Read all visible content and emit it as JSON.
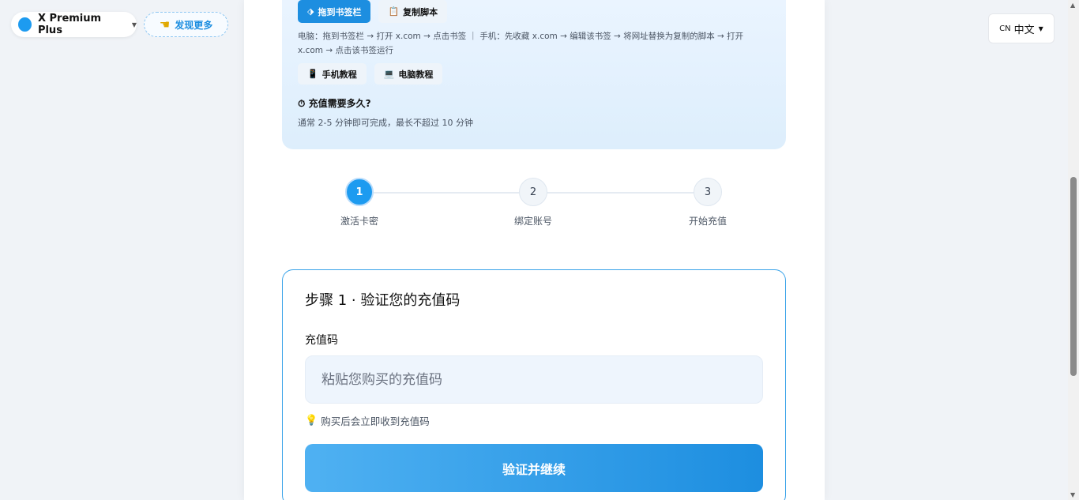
{
  "header": {
    "product_name": "X Premium Plus",
    "discover_label": "发现更多",
    "lang_flag": "CN",
    "lang_label": "中文"
  },
  "info": {
    "drag_bookmark_label": "拖到书签栏",
    "copy_script_label": "复制脚本",
    "instructions": "电脑：拖到书签栏 → 打开 x.com → 点击书签 ｜ 手机：先收藏 x.com → 编辑该书签 → 将网址替换为复制的脚本 → 打开 x.com → 点击该书签运行",
    "mobile_tutorial_label": "手机教程",
    "desktop_tutorial_label": "电脑教程",
    "faq_question": "充值需要多久?",
    "faq_answer": "通常 2-5 分钟即可完成，最长不超过 10 分钟"
  },
  "stepper": {
    "steps": [
      {
        "number": "1",
        "label": "激活卡密",
        "active": true
      },
      {
        "number": "2",
        "label": "绑定账号",
        "active": false
      },
      {
        "number": "3",
        "label": "开始充值",
        "active": false
      }
    ]
  },
  "form": {
    "title": "步骤 1 · 验证您的充值码",
    "field_label": "充值码",
    "input_value": "",
    "input_placeholder": "粘贴您购买的充值码",
    "hint": "购买后会立即收到充值码",
    "submit_label": "验证并继续"
  },
  "colors": {
    "accent": "#1d9bf0",
    "button_gradient_start": "#4fb1f2",
    "button_gradient_end": "#1d8ee0",
    "info_bg": "#eaf4ff"
  }
}
